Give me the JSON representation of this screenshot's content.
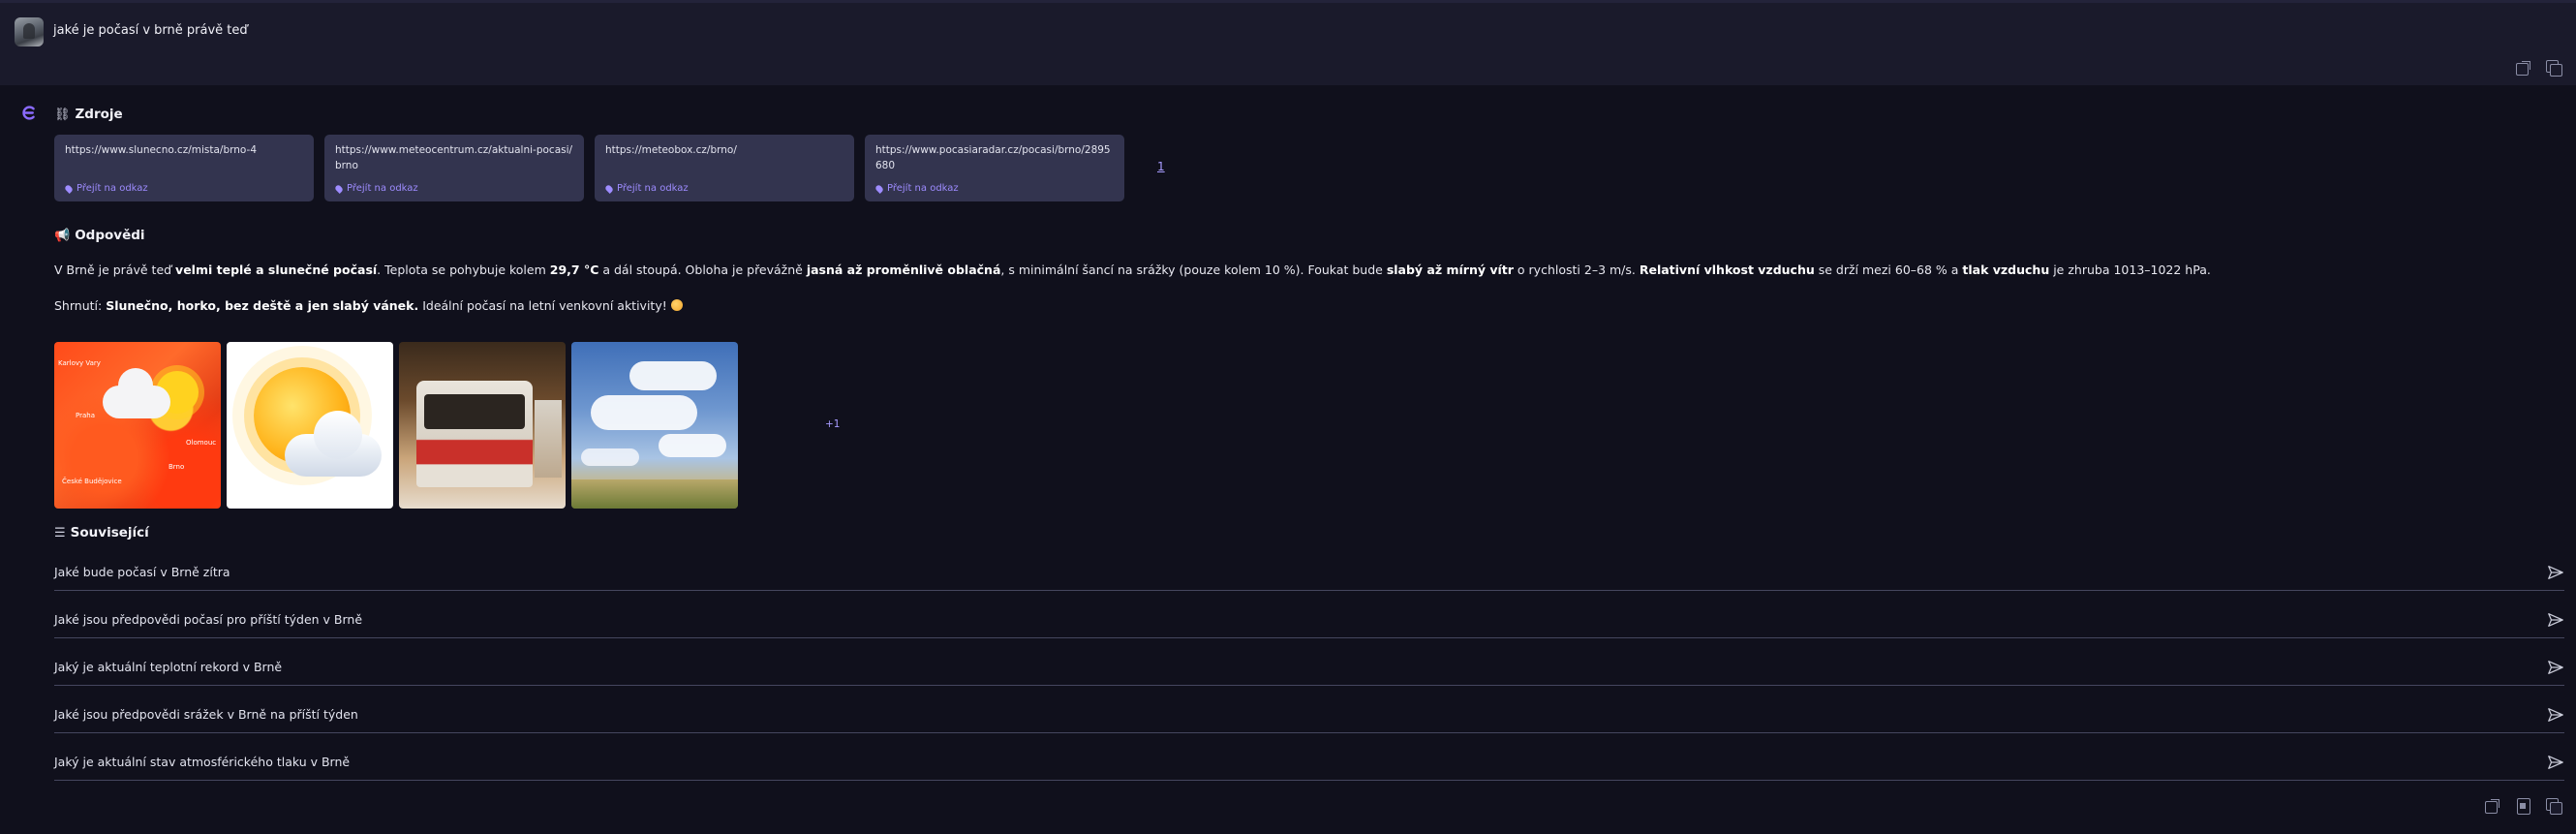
{
  "query": {
    "text": "jaké je počasí v brně právě teď"
  },
  "icons": {
    "external": "external-link-icon",
    "copy": "copy-icon",
    "pdf": "pdf-icon",
    "send": "send-icon",
    "brand": "brand-logo-icon",
    "sources_header": "link-icon",
    "answer_header": "megaphone-icon",
    "related_header": "list-icon"
  },
  "sources": {
    "title": "Zdroje",
    "link_label": "Přejít na odkaz",
    "items": [
      {
        "url": "https://www.slunecno.cz/mista/brno-4"
      },
      {
        "url": "https://www.meteocentrum.cz/aktualni-pocasi/brno"
      },
      {
        "url": "https://meteobox.cz/brno/"
      },
      {
        "url": "https://www.pocasiaradar.cz/pocasi/brno/2895680"
      }
    ],
    "more_count": "1"
  },
  "answer": {
    "title": "Odpovědi",
    "p1": {
      "t1": "V Brně je právě teď ",
      "b1": "velmi teplé a slunečné počasí",
      "t2": ". Teplota se pohybuje kolem ",
      "b2": "29,7 °C",
      "t3": " a dál stoupá. Obloha je převážně ",
      "b3": "jasná až proměnlivě oblačná",
      "t4": ", s minimální šancí na srážky (pouze kolem 10 %). Foukat bude ",
      "b4": "slabý až mírný vítr",
      "t5": " o rychlosti 2–3 m/s. ",
      "b5": "Relativní vlhkost vzduchu",
      "t6": " se drží mezi 60–68 % a ",
      "b6": "tlak vzduchu",
      "t7": " je zhruba 1013–1022 hPa."
    },
    "p2": {
      "t1": "Shrnutí: ",
      "b1": "Slunečno, horko, bez deště a jen slabý vánek.",
      "t2": " Ideální počasí na letní venkovní aktivity! "
    }
  },
  "images": {
    "items": [
      {
        "name": "weather-map-image",
        "labels": [
          "Praha",
          "Brno",
          "Olomouc",
          "České Budějovice",
          "Karlovy Vary"
        ]
      },
      {
        "name": "sun-cloud-image"
      },
      {
        "name": "bus-in-snow-image"
      },
      {
        "name": "sky-clouds-image"
      }
    ],
    "more_label": "+1"
  },
  "related": {
    "title": "Související",
    "items": [
      {
        "text": "Jaké bude počasí v Brně zítra"
      },
      {
        "text": "Jaké jsou předpovědi počasí pro příští týden v Brně"
      },
      {
        "text": "Jaký je aktuální teplotní rekord v Brně"
      },
      {
        "text": "Jaké jsou předpovědi srážek v Brně na příští týden"
      },
      {
        "text": "Jaký je aktuální stav atmosférického tlaku v Brně"
      }
    ]
  }
}
